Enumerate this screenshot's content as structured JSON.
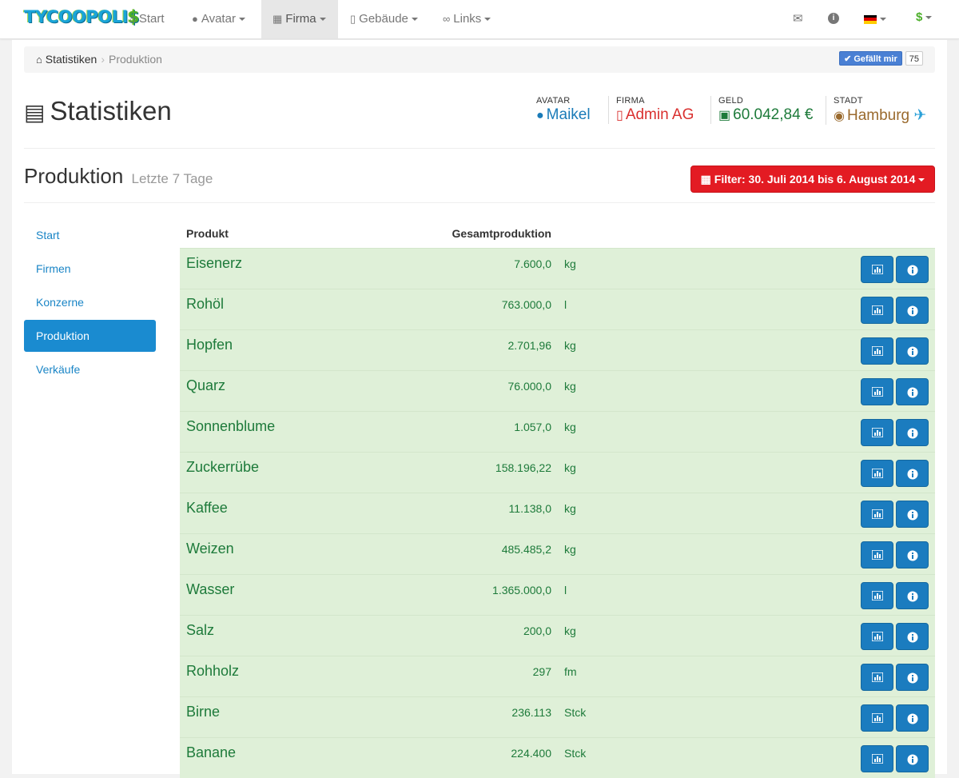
{
  "nav": {
    "brand_main": "TYCOOPOLI",
    "brand_end": "$",
    "items": [
      {
        "label": "Start",
        "icon": "home-icon"
      },
      {
        "label": "Avatar",
        "icon": "user-icon"
      },
      {
        "label": "Firma",
        "icon": "briefcase-icon"
      },
      {
        "label": "Gebäude",
        "icon": "building-icon"
      },
      {
        "label": "Links",
        "icon": "link-icon"
      }
    ]
  },
  "breadcrumb": {
    "root": "Statistiken",
    "current": "Produktion"
  },
  "like": {
    "label": "Gefällt mir",
    "count": "75"
  },
  "header": {
    "title": "Statistiken",
    "avatar_label": "AVATAR",
    "avatar_value": "Maikel",
    "firma_label": "FIRMA",
    "firma_value": "Admin AG",
    "geld_label": "GELD",
    "geld_value": "60.042,84 €",
    "stadt_label": "STADT",
    "stadt_value": "Hamburg",
    "colors": {
      "avatar": "#1a7bb8",
      "firma": "#d9302f",
      "geld": "#1d7a3a",
      "stadt": "#9a6a2e"
    }
  },
  "section": {
    "title": "Produktion",
    "subtitle": "Letzte 7 Tage",
    "filter_label": "Filter: 30. Juli 2014 bis 6. August 2014"
  },
  "sidenav": {
    "items": [
      "Start",
      "Firmen",
      "Konzerne",
      "Produktion",
      "Verkäufe"
    ],
    "active": "Produktion"
  },
  "table": {
    "col_product": "Produkt",
    "col_total": "Gesamtproduktion",
    "rows": [
      {
        "name": "Eisenerz",
        "amount": "7.600,0",
        "unit": "kg"
      },
      {
        "name": "Rohöl",
        "amount": "763.000,0",
        "unit": "l"
      },
      {
        "name": "Hopfen",
        "amount": "2.701,96",
        "unit": "kg"
      },
      {
        "name": "Quarz",
        "amount": "76.000,0",
        "unit": "kg"
      },
      {
        "name": "Sonnenblume",
        "amount": "1.057,0",
        "unit": "kg"
      },
      {
        "name": "Zuckerrübe",
        "amount": "158.196,22",
        "unit": "kg"
      },
      {
        "name": "Kaffee",
        "amount": "11.138,0",
        "unit": "kg"
      },
      {
        "name": "Weizen",
        "amount": "485.485,2",
        "unit": "kg"
      },
      {
        "name": "Wasser",
        "amount": "1.365.000,0",
        "unit": "l"
      },
      {
        "name": "Salz",
        "amount": "200,0",
        "unit": "kg"
      },
      {
        "name": "Rohholz",
        "amount": "297",
        "unit": "fm"
      },
      {
        "name": "Birne",
        "amount": "236.113",
        "unit": "Stck"
      },
      {
        "name": "Banane",
        "amount": "224.400",
        "unit": "Stck"
      }
    ]
  }
}
